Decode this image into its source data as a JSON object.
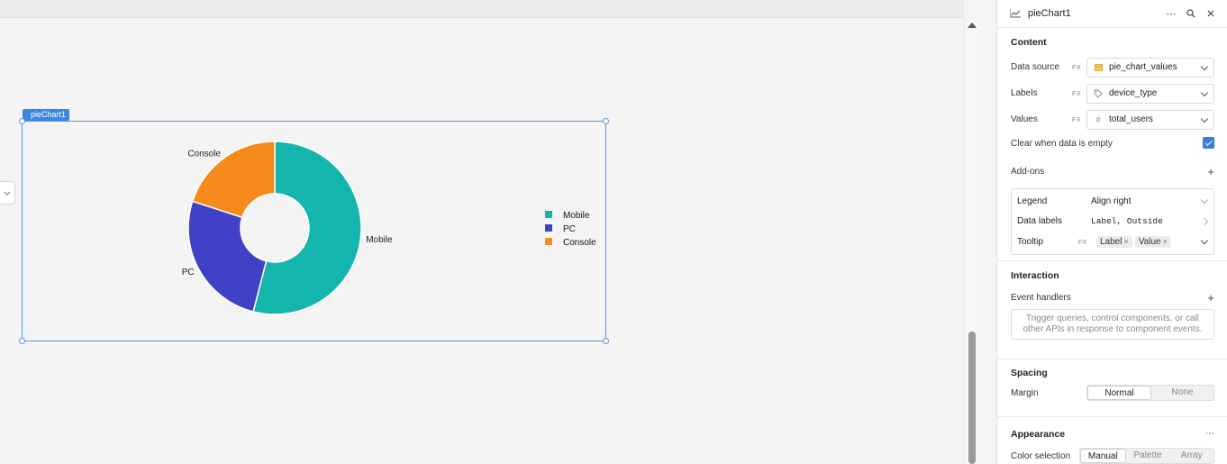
{
  "widget": {
    "tag": "pieChart1"
  },
  "chart_data": {
    "type": "pie",
    "donut": true,
    "categories": [
      "Mobile",
      "PC",
      "Console"
    ],
    "values": [
      54,
      26,
      20
    ],
    "colors": [
      "#13b5ac",
      "#4141c8",
      "#f68a1a"
    ],
    "legend_position": "right",
    "data_labels": "outside"
  },
  "inspector": {
    "title": "pieChart1",
    "icons": {
      "chart": "line-chart-icon",
      "more": "more-icon",
      "search": "search-icon",
      "close": "close-icon"
    },
    "content": {
      "title": "Content",
      "fx": "FX",
      "data_source": {
        "label": "Data source",
        "value": "pie_chart_values"
      },
      "labels": {
        "label": "Labels",
        "value": "device_type"
      },
      "values": {
        "label": "Values",
        "value": "total_users"
      },
      "clear_when_empty": {
        "label": "Clear when data is empty",
        "checked": true
      },
      "addons": {
        "title": "Add-ons",
        "legend": {
          "label": "Legend",
          "value": "Align right"
        },
        "data_labels": {
          "label": "Data labels",
          "value": "Label, Outside"
        },
        "tooltip": {
          "label": "Tooltip",
          "fx": "FX",
          "pills": [
            "Label",
            "Value"
          ]
        }
      }
    },
    "interaction": {
      "title": "Interaction",
      "event_handlers_label": "Event handlers",
      "placeholder_line1": "Trigger queries, control components, or call",
      "placeholder_line2": "other APIs in response to component events."
    },
    "spacing": {
      "title": "Spacing",
      "margin_label": "Margin",
      "options": [
        "Normal",
        "None"
      ],
      "selected": "Normal"
    },
    "appearance": {
      "title": "Appearance",
      "color_selection_label": "Color selection",
      "options": [
        "Manual",
        "Palette",
        "Array"
      ],
      "selected": "Manual"
    }
  }
}
